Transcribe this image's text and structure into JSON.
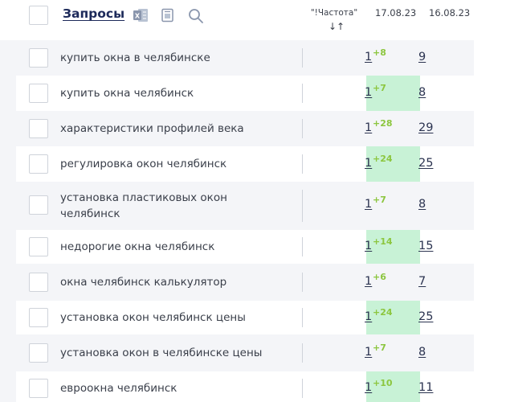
{
  "header": {
    "title": "Запросы",
    "freq_label": "\"!Частота\"",
    "sort_glyph": "↓↑",
    "date_current": "17.08.23",
    "date_prev": "16.08.23"
  },
  "icons": [
    "excel-icon",
    "export-icon",
    "search-icon"
  ],
  "colors": {
    "green_column": "#c8f2d6",
    "delta_green": "#8cc63f",
    "title": "#1d2a5a"
  },
  "rows": [
    {
      "keyword": "купить окна в челябинске",
      "position": "1",
      "delta": "+8",
      "prev": "9"
    },
    {
      "keyword": "купить окна челябинск",
      "position": "1",
      "delta": "+7",
      "prev": "8"
    },
    {
      "keyword": "характеристики профилей века",
      "position": "1",
      "delta": "+28",
      "prev": "29"
    },
    {
      "keyword": "регулировка окон челябинск",
      "position": "1",
      "delta": "+24",
      "prev": "25"
    },
    {
      "keyword": "установка пластиковых окон челябинск",
      "position": "1",
      "delta": "+7",
      "prev": "8"
    },
    {
      "keyword": "недорогие окна челябинск",
      "position": "1",
      "delta": "+14",
      "prev": "15"
    },
    {
      "keyword": "окна челябинск калькулятор",
      "position": "1",
      "delta": "+6",
      "prev": "7"
    },
    {
      "keyword": "установка окон челябинск цены",
      "position": "1",
      "delta": "+24",
      "prev": "25"
    },
    {
      "keyword": "установка окон в челябинске цены",
      "position": "1",
      "delta": "+7",
      "prev": "8"
    },
    {
      "keyword": "евроокна челябинск",
      "position": "1",
      "delta": "+10",
      "prev": "11"
    }
  ]
}
